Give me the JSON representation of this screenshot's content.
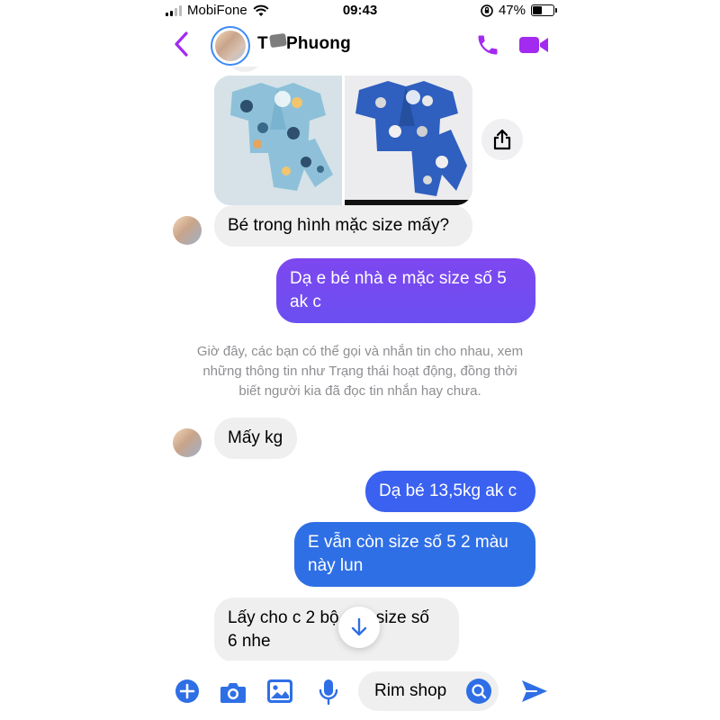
{
  "status_bar": {
    "carrier": "MobiFone",
    "time": "09:43",
    "battery_percent": "47%",
    "battery_level": 0.47
  },
  "header": {
    "contact_name": "Phuong",
    "back_icon": "chevron-left-icon",
    "call_icon": "phone-icon",
    "video_icon": "video-camera-icon",
    "accent_color": "#a32bf0"
  },
  "messages": [
    {
      "direction": "incoming",
      "type": "image",
      "images": [
        "light blue pajama set with round prints",
        "dark blue pajama set with bear prints"
      ]
    },
    {
      "direction": "incoming",
      "type": "text",
      "text": "Bé trong hình mặc size mấy?"
    },
    {
      "direction": "outgoing",
      "type": "text",
      "lines": [
        "Dạ e bé nhà e mặc size số 5",
        "ak c"
      ]
    },
    {
      "direction": "system",
      "type": "note",
      "lines": [
        "Giờ đây, các bạn có thể gọi và nhắn tin cho nhau, xem",
        "những thông tin như Trạng thái hoạt động, đồng thời",
        "biết người kia đã đọc tin nhắn hay chưa."
      ]
    },
    {
      "direction": "incoming",
      "type": "text",
      "text": "Mấy kg"
    },
    {
      "direction": "outgoing",
      "type": "text",
      "text": "Dạ bé 13,5kg ak c"
    },
    {
      "direction": "outgoing",
      "type": "text",
      "lines": [
        "E vẫn còn size số 5 2 màu",
        "này lun"
      ]
    },
    {
      "direction": "incoming",
      "type": "text",
      "lines": [
        "Lấy cho c 2 bộ này size số",
        "6 nhe"
      ]
    }
  ],
  "colors": {
    "outgoing_gradient_top": "#7e47f0",
    "outgoing_gradient_bottom": "#3b5ef0",
    "outgoing_blue": "#2f6fe5",
    "incoming_bubble": "#efefef",
    "system_text": "#8e8e93"
  },
  "composer": {
    "input_value": "Rim shop",
    "icons": [
      "plus-icon",
      "camera-icon",
      "image-icon",
      "microphone-icon",
      "emoji-icon",
      "send-icon"
    ]
  }
}
